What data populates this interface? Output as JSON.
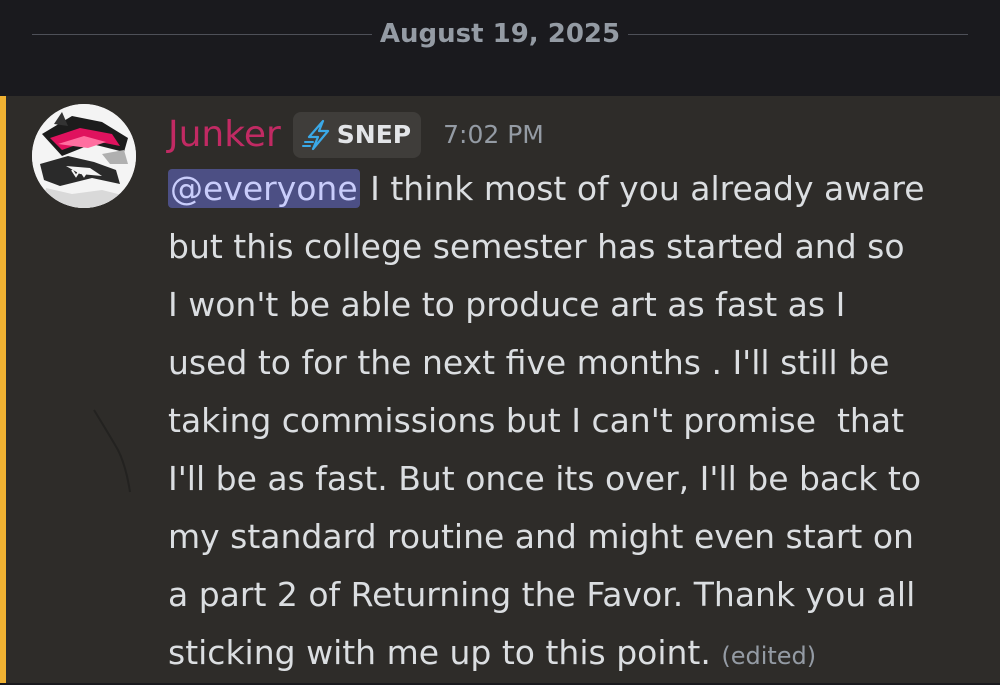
{
  "date_divider": {
    "label": "August 19, 2025"
  },
  "message": {
    "author": "Junker",
    "author_color": "#c12a63",
    "tag": {
      "icon": "lightning-bolt-icon",
      "label": "SNEP"
    },
    "timestamp": "7:02 PM",
    "mention": "@everyone",
    "lines": [
      " I think most of you already aware",
      "but this college semester has started and so",
      "I won't be able to produce art as fast as I",
      "used to for the next five months . I'll still be",
      "taking commissions but I can't promise  that",
      "I'll be as fast. But once its over, I'll be back to",
      "my standard routine and might even start on",
      "a part 2 of Returning the Favor. Thank you all",
      "sticking with me up to this point."
    ],
    "edited": "(edited)",
    "highlight_color": "#f0b232"
  }
}
